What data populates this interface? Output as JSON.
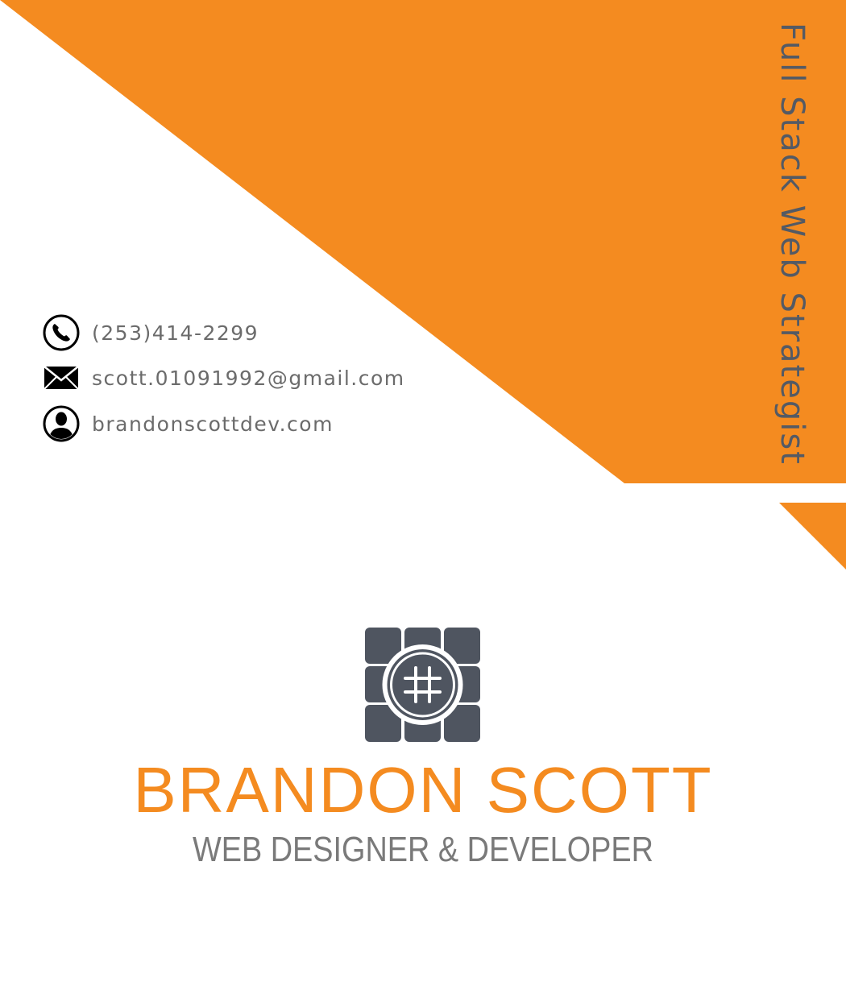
{
  "colors": {
    "accent": "#F48B20",
    "dark": "#4F5560",
    "text_gray": "#6B6B6B"
  },
  "tagline": "Full Stack Web Strategist",
  "contacts": [
    {
      "icon": "phone-icon",
      "text": "(253)414-2299"
    },
    {
      "icon": "mail-icon",
      "text": "scott.01091992@gmail.com"
    },
    {
      "icon": "user-icon",
      "text": "brandonscottdev.com"
    }
  ],
  "logo": {
    "icon": "hashtag-grid-logo"
  },
  "name": "BRANDON SCOTT",
  "role": "WEB DESIGNER & DEVELOPER"
}
